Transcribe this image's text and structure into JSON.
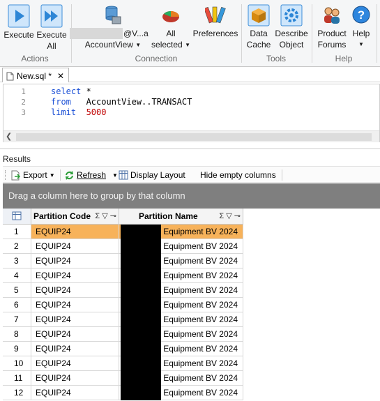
{
  "ribbon": {
    "groups": {
      "actions": "Actions",
      "connection": "Connection",
      "tools": "Tools",
      "help": "Help"
    },
    "buttons": {
      "execute": "Execute",
      "execute_all_line1": "Execute",
      "execute_all_line2": "All",
      "connection_name_suffix": "@V...a",
      "connection_view": "AccountView",
      "all_line1": "All",
      "all_line2": "selected",
      "preferences": "Preferences",
      "data_cache_line1": "Data",
      "data_cache_line2": "Cache",
      "describe_line1": "Describe",
      "describe_line2": "Object",
      "product_forums_line1": "Product",
      "product_forums_line2": "Forums",
      "help": "Help"
    }
  },
  "editor": {
    "tab_label": "New.sql *",
    "close_glyph": "✕",
    "line_numbers": [
      "1",
      "2",
      "3"
    ],
    "lines": [
      {
        "keyword": "select",
        "rest": " *"
      },
      {
        "keyword": "from",
        "rest": "   AccountView..TRANSACT"
      },
      {
        "keyword": "limit",
        "number": "5000"
      }
    ]
  },
  "results": {
    "label": "Results",
    "toolbar": {
      "export": "Export",
      "refresh": "Refresh",
      "display_layout": "Display Layout",
      "hide_empty": "Hide empty columns"
    },
    "group_hint": "Drag a column here to group by that column",
    "columns": [
      {
        "name": "Partition Code",
        "tools": "Σ ▽ ⊸"
      },
      {
        "name": "Partition Name",
        "tools": "Σ ▽ ⊸"
      }
    ],
    "rows": [
      {
        "n": "1",
        "code": "EQUIP24",
        "name": "Equipment BV 2024"
      },
      {
        "n": "2",
        "code": "EQUIP24",
        "name": "Equipment BV 2024"
      },
      {
        "n": "3",
        "code": "EQUIP24",
        "name": "Equipment BV 2024"
      },
      {
        "n": "4",
        "code": "EQUIP24",
        "name": "Equipment BV 2024"
      },
      {
        "n": "5",
        "code": "EQUIP24",
        "name": "Equipment BV 2024"
      },
      {
        "n": "6",
        "code": "EQUIP24",
        "name": "Equipment BV 2024"
      },
      {
        "n": "7",
        "code": "EQUIP24",
        "name": "Equipment BV 2024"
      },
      {
        "n": "8",
        "code": "EQUIP24",
        "name": "Equipment BV 2024"
      },
      {
        "n": "9",
        "code": "EQUIP24",
        "name": "Equipment BV 2024"
      },
      {
        "n": "10",
        "code": "EQUIP24",
        "name": "Equipment BV 2024"
      },
      {
        "n": "11",
        "code": "EQUIP24",
        "name": "Equipment BV 2024"
      },
      {
        "n": "12",
        "code": "EQUIP24",
        "name": "Equipment BV 2024"
      }
    ],
    "selected_row": "1"
  },
  "colors": {
    "selection": "#f7b25a",
    "group_bar": "#7f7f7f",
    "keyword": "#1a4fd6",
    "number": "#c00000"
  }
}
